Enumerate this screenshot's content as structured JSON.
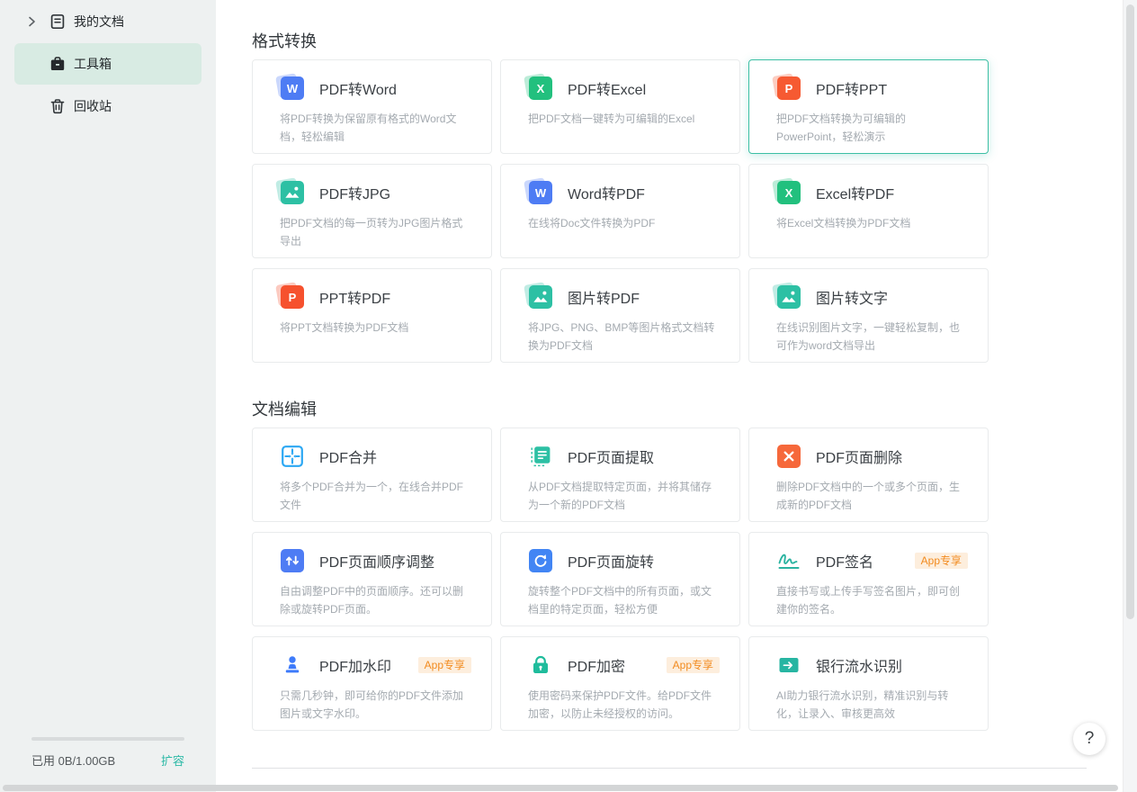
{
  "colors": {
    "accent": "#2cb9a6",
    "highlight_border": "#3cbfa4",
    "sidebar_bg": "#eef1f1",
    "sidebar_selected_bg": "#d8ebe3",
    "badge_bg": "#fdeedd",
    "badge_text": "#f28b1f",
    "card_border": "#e9ebec",
    "title_text": "#3b4045",
    "desc_text": "#a4aab0"
  },
  "sidebar": {
    "items": [
      {
        "label": "我的文档",
        "icon": "document-icon",
        "expandable": true,
        "selected": false
      },
      {
        "label": "工具箱",
        "icon": "toolbox-icon",
        "expandable": false,
        "selected": true
      },
      {
        "label": "回收站",
        "icon": "trash-icon",
        "expandable": false,
        "selected": false
      }
    ],
    "storage": {
      "used_label": "已用 0B/1.00GB",
      "expand_label": "扩容"
    }
  },
  "sections": [
    {
      "title": "格式转换",
      "tools": [
        {
          "title": "PDF转Word",
          "desc": "将PDF转换为保留原有格式的Word文档，轻松编辑",
          "icon": "pdf-to-word-icon",
          "style": "stack",
          "glyph": "W",
          "color": "#4e7cf4"
        },
        {
          "title": "PDF转Excel",
          "desc": "把PDF文档一键转为可编辑的Excel",
          "icon": "pdf-to-excel-icon",
          "style": "stack",
          "glyph": "X",
          "color": "#22c07e"
        },
        {
          "title": "PDF转PPT",
          "desc": "把PDF文档转换为可编辑的PowerPoint，轻松演示",
          "icon": "pdf-to-ppt-icon",
          "style": "stack",
          "glyph": "P",
          "color": "#f65a32",
          "highlighted": true
        },
        {
          "title": "PDF转JPG",
          "desc": "把PDF文档的每一页转为JPG图片格式导出",
          "icon": "pdf-to-jpg-icon",
          "style": "stack",
          "svg": "image",
          "color": "#2dc0a4"
        },
        {
          "title": "Word转PDF",
          "desc": "在线将Doc文件转换为PDF",
          "icon": "word-to-pdf-icon",
          "style": "stack",
          "glyph": "W",
          "color": "#4e7cf4"
        },
        {
          "title": "Excel转PDF",
          "desc": "将Excel文档转换为PDF文档",
          "icon": "excel-to-pdf-icon",
          "style": "stack",
          "glyph": "X",
          "color": "#22c07e"
        },
        {
          "title": "PPT转PDF",
          "desc": "将PPT文档转换为PDF文档",
          "icon": "ppt-to-pdf-icon",
          "style": "stack",
          "glyph": "P",
          "color": "#f6512e"
        },
        {
          "title": "图片转PDF",
          "desc": "将JPG、PNG、BMP等图片格式文档转换为PDF文档",
          "icon": "image-to-pdf-icon",
          "style": "stack",
          "svg": "image",
          "color": "#2dc0a4"
        },
        {
          "title": "图片转文字",
          "desc": "在线识别图片文字，一键轻松复制，也可作为word文档导出",
          "icon": "image-to-text-icon",
          "style": "stack",
          "svg": "image",
          "color": "#2dc0a4"
        }
      ]
    },
    {
      "title": "文档编辑",
      "tools": [
        {
          "title": "PDF合并",
          "desc": "将多个PDF合并为一个，在线合并PDF文件",
          "icon": "pdf-merge-icon",
          "svg": "merge",
          "color": "#2ba7f3"
        },
        {
          "title": "PDF页面提取",
          "desc": "从PDF文档提取特定页面，并将其储存为一个新的PDF文档",
          "icon": "extract-pages-icon",
          "svg": "extract",
          "color": "#2dc0a4"
        },
        {
          "title": "PDF页面删除",
          "desc": "删除PDF文档中的一个或多个页面，生成新的PDF文档",
          "icon": "delete-pages-icon",
          "svg": "delete",
          "color": "#f6683b"
        },
        {
          "title": "PDF页面顺序调整",
          "desc": "自由调整PDF中的页面顺序。还可以删除或旋转PDF页面。",
          "icon": "reorder-pages-icon",
          "svg": "reorder",
          "color": "#4e7cf4"
        },
        {
          "title": "PDF页面旋转",
          "desc": "旋转整个PDF文档中的所有页面，或文档里的特定页面，轻松方便",
          "icon": "rotate-pages-icon",
          "svg": "rotate",
          "color": "#4285f4"
        },
        {
          "title": "PDF签名",
          "desc": "直接书写或上传手写签名图片，即可创建你的签名。",
          "icon": "signature-icon",
          "svg": "sign",
          "color": "#2ab3a0",
          "badge": "App专享"
        },
        {
          "title": "PDF加水印",
          "desc": "只需几秒钟，即可给你的PDF文件添加图片或文字水印。",
          "icon": "watermark-icon",
          "svg": "stamp",
          "color": "#3e7bfa",
          "badge": "App专享"
        },
        {
          "title": "PDF加密",
          "desc": "使用密码来保护PDF文件。给PDF文件加密，以防止未经授权的访问。",
          "icon": "encrypt-icon",
          "svg": "lock",
          "color": "#1fbc9c",
          "badge": "App专享"
        },
        {
          "title": "银行流水识别",
          "desc": "AI助力银行流水识别，精准识别与转化，让录入、审核更高效",
          "icon": "bank-statement-icon",
          "svg": "bankcard",
          "color": "#27b5a2"
        }
      ]
    }
  ],
  "help": {
    "label": "?"
  }
}
